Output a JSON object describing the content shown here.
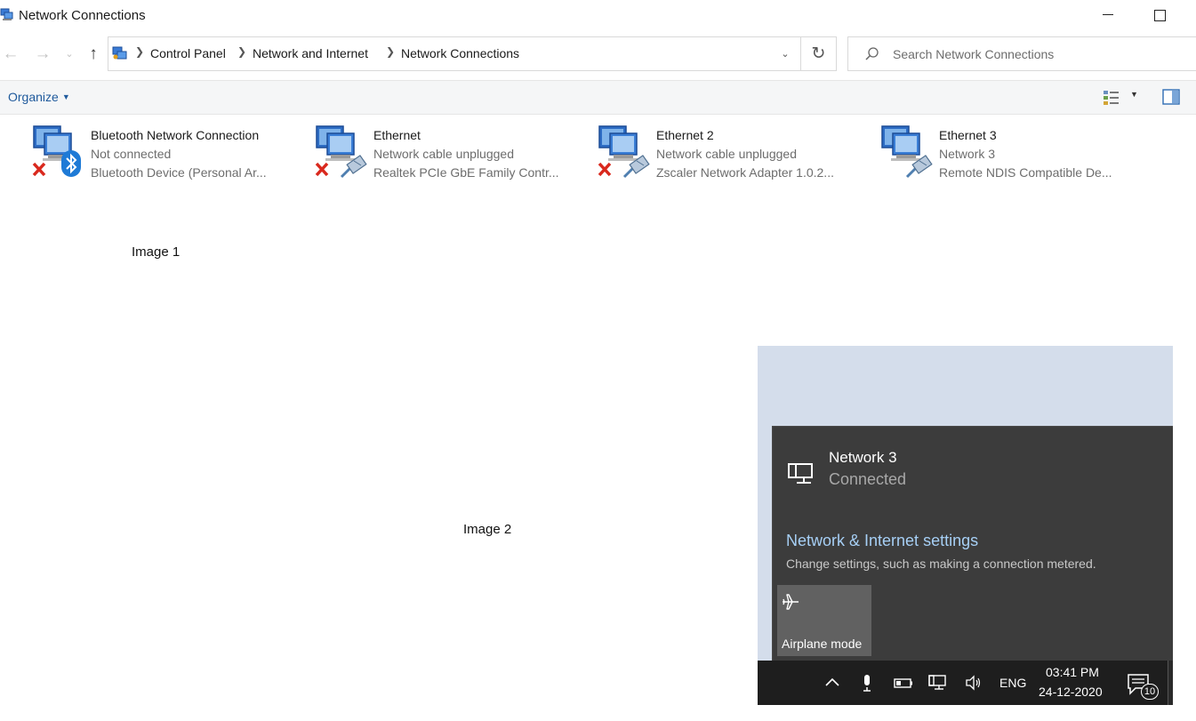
{
  "window": {
    "title": "Network Connections"
  },
  "breadcrumb": [
    "Control Panel",
    "Network and Internet",
    "Network Connections"
  ],
  "search": {
    "placeholder": "Search Network Connections"
  },
  "toolbar": {
    "organize_label": "Organize"
  },
  "connections": [
    {
      "name": "Bluetooth Network Connection",
      "status": "Not connected",
      "device": "Bluetooth Device (Personal Ar...",
      "disconnected": true,
      "icon": "bluetooth-icon"
    },
    {
      "name": "Ethernet",
      "status": "Network cable unplugged",
      "device": "Realtek PCIe GbE Family Contr...",
      "disconnected": true,
      "icon": "ethernet-cable-icon"
    },
    {
      "name": "Ethernet 2",
      "status": "Network cable unplugged",
      "device": "Zscaler Network Adapter 1.0.2...",
      "disconnected": true,
      "icon": "ethernet-cable-icon"
    },
    {
      "name": "Ethernet 3",
      "status": "Network 3",
      "device": "Remote NDIS Compatible De...",
      "disconnected": false,
      "icon": "ethernet-cable-icon"
    }
  ],
  "captions": {
    "image1": "Image 1",
    "image2": "Image 2"
  },
  "flyout": {
    "network_name": "Network 3",
    "network_status": "Connected",
    "settings_link": "Network & Internet settings",
    "settings_desc": "Change settings, such as making a connection metered.",
    "airplane_label": "Airplane mode"
  },
  "taskbar": {
    "language": "ENG",
    "time": "03:41 PM",
    "date": "24-12-2020",
    "notification_count": "10"
  },
  "colors": {
    "link": "#1f5a9c",
    "flyout_bg": "#3c3c3c",
    "flyout_link": "#a6cff5",
    "taskbar_bg": "#1e1e1e",
    "error_red": "#d9281d"
  }
}
